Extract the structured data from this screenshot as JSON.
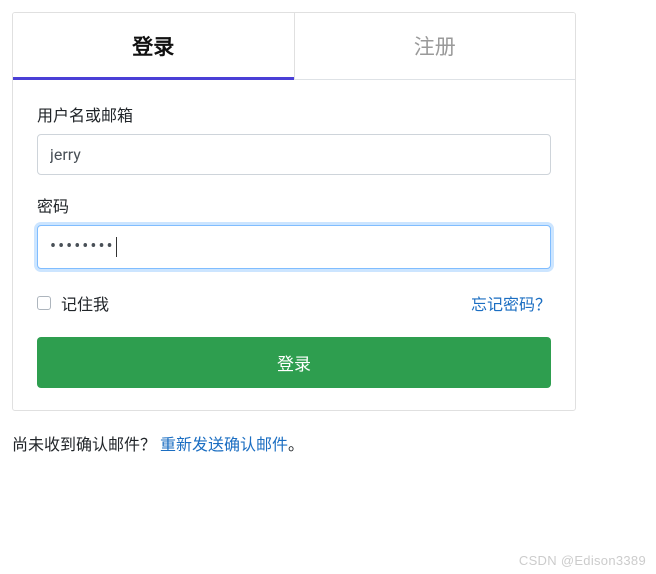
{
  "tabs": {
    "login": "登录",
    "register": "注册"
  },
  "form": {
    "username_label": "用户名或邮箱",
    "username_value": "jerry",
    "password_label": "密码",
    "password_value": "••••••••",
    "remember_label": "记住我",
    "forgot_link": "忘记密码？",
    "submit_label": "登录"
  },
  "footer": {
    "prompt": "尚未收到确认邮件？ ",
    "resend_link": "重新发送确认邮件",
    "period": "。"
  },
  "watermark": "CSDN @Edison3389"
}
